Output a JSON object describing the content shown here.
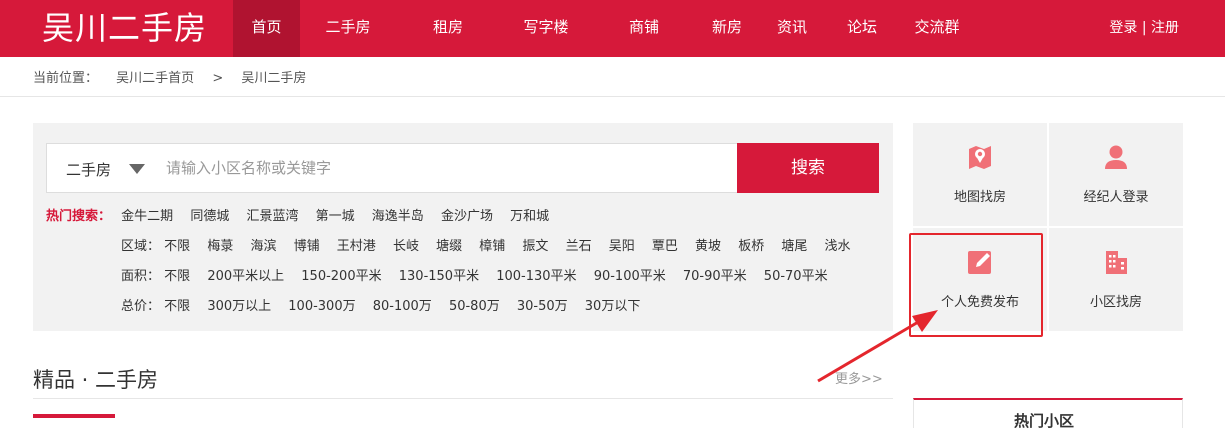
{
  "header": {
    "logo": "吴川二手房",
    "nav": [
      "首页",
      "二手房",
      "租房",
      "写字楼",
      "商铺",
      "新房",
      "资讯",
      "论坛",
      "交流群"
    ],
    "login": "登录",
    "divider": "|",
    "register": "注册"
  },
  "breadcrumb": {
    "prefix": "当前位置：",
    "home": "吴川二手首页",
    "arrow": ">",
    "current": "吴川二手房"
  },
  "search": {
    "type_selected": "二手房",
    "placeholder": "请输入小区名称或关键字",
    "button": "搜索"
  },
  "hot_search": {
    "label": "热门搜索：",
    "tags": [
      "金牛二期",
      "同德城",
      "汇景蓝湾",
      "第一城",
      "海逸半岛",
      "金沙广场",
      "万和城"
    ]
  },
  "filters": {
    "area": {
      "label": "区域：",
      "options": [
        "不限",
        "梅菉",
        "海滨",
        "博铺",
        "王村港",
        "长岐",
        "塘缀",
        "樟铺",
        "振文",
        "兰石",
        "吴阳",
        "覃巴",
        "黄坡",
        "板桥",
        "塘尾",
        "浅水"
      ]
    },
    "size": {
      "label": "面积：",
      "options": [
        "不限",
        "200平米以上",
        "150-200平米",
        "130-150平米",
        "100-130平米",
        "90-100平米",
        "70-90平米",
        "50-70平米"
      ]
    },
    "price": {
      "label": "总价：",
      "options": [
        "不限",
        "300万以上",
        "100-300万",
        "80-100万",
        "50-80万",
        "30-50万",
        "30万以下"
      ]
    }
  },
  "side_links": {
    "map": "地图找房",
    "agent": "经纪人登录",
    "publish": "个人免费发布",
    "estate": "小区找房"
  },
  "section": {
    "title": "精品 · 二手房",
    "more": "更多>>"
  },
  "hot_estate_title": "热门小区",
  "colors": {
    "brand": "#d6193a",
    "icon": "#f07077",
    "highlight": "#e4262d"
  }
}
